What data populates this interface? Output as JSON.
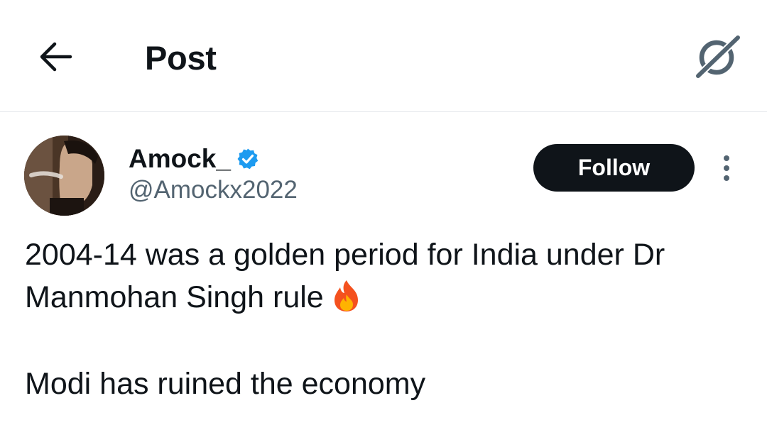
{
  "header": {
    "title": "Post",
    "back_icon": "arrow-left-icon",
    "grok_icon": "grok-icon"
  },
  "author": {
    "display_name": "Amock_",
    "handle": "@Amockx2022",
    "verified": true,
    "verified_color": "#1d9bf0"
  },
  "actions": {
    "follow_label": "Follow",
    "more_icon": "more-vertical-icon"
  },
  "post": {
    "line1": "2004-14 was a golden period for India under Dr",
    "line2": "Manmohan Singh rule",
    "line2_emoji": "fire-emoji",
    "line3": "Modi has ruined the economy"
  },
  "colors": {
    "text": "#0f1419",
    "secondary": "#536471",
    "follow_bg": "#0f1419",
    "divider": "#e6e9ec"
  }
}
